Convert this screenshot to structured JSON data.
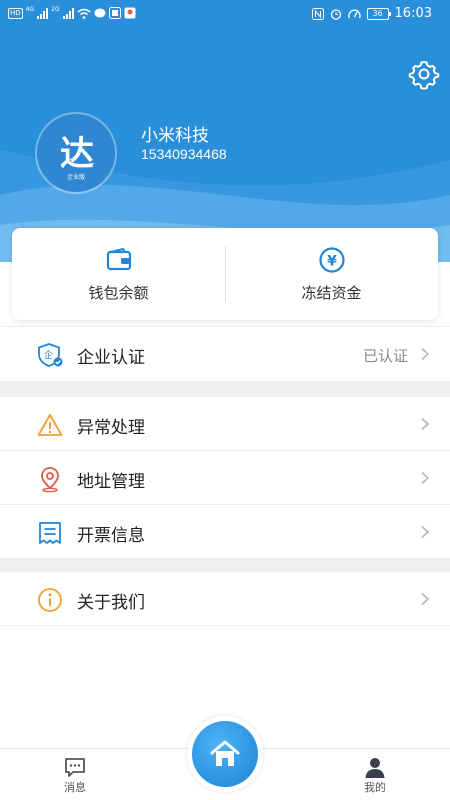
{
  "status_bar": {
    "left_badges": [
      "HD",
      "4G",
      "2G"
    ],
    "battery": "36",
    "time": "16:03"
  },
  "profile": {
    "avatar_logo": "达",
    "avatar_caption": "企业版",
    "company_name": "小米科技",
    "phone": "15340934468"
  },
  "wallet": {
    "balance_label": "钱包余额",
    "frozen_label": "冻结资金",
    "frozen_icon_symbol": "¥"
  },
  "menu": {
    "enterprise_cert": {
      "label": "企业认证",
      "value": "已认证",
      "icon_symbol": "企"
    },
    "exception": {
      "label": "异常处理"
    },
    "address": {
      "label": "地址管理"
    },
    "invoice": {
      "label": "开票信息"
    },
    "about": {
      "label": "关于我们"
    }
  },
  "nav": {
    "messages_label": "消息",
    "mine_label": "我的"
  },
  "colors": {
    "brand_blue": "#2a8fdb",
    "accent_blue": "#1f86d8",
    "warning_orange": "#f0a030",
    "location_red": "#e05a4a"
  }
}
